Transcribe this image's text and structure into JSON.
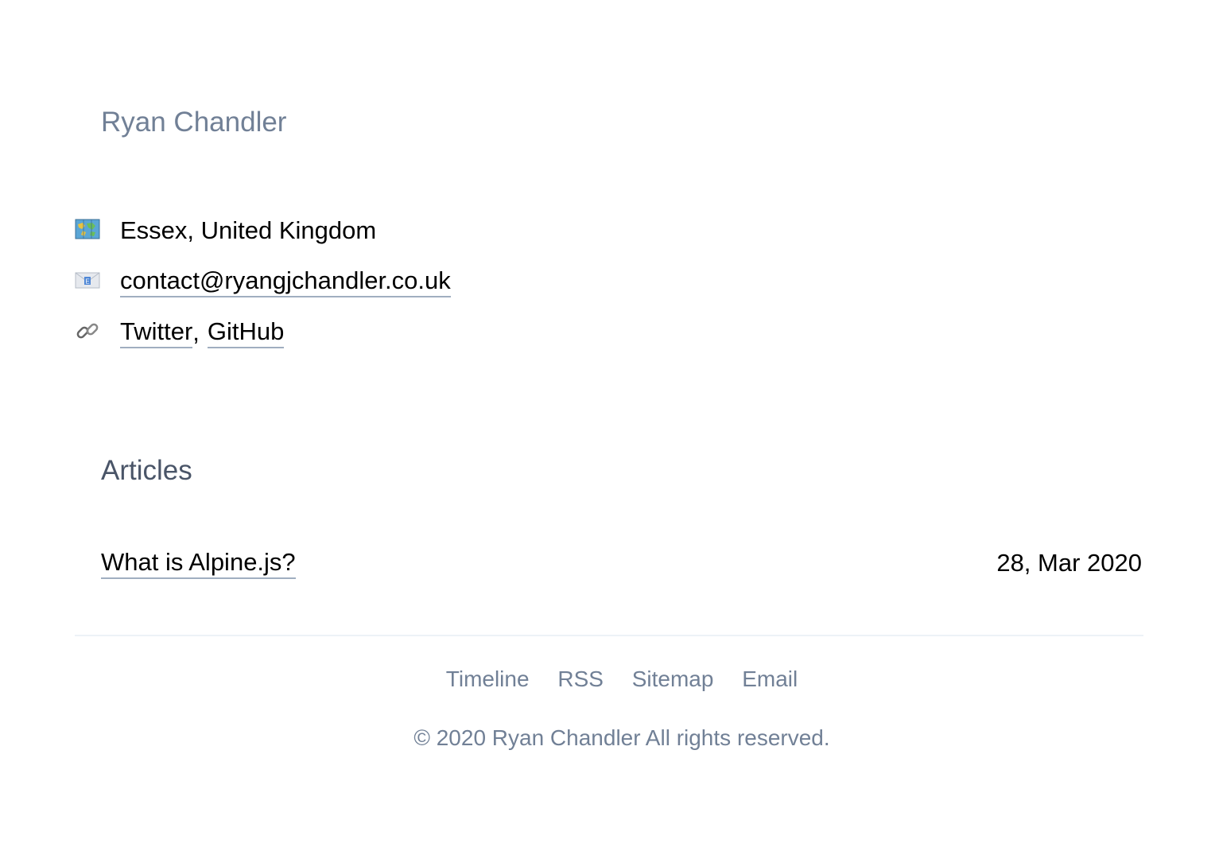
{
  "header": {
    "site_name": "Ryan Chandler"
  },
  "info": {
    "location": {
      "icon": "world-map-icon",
      "text": "Essex, United Kingdom"
    },
    "email": {
      "icon": "envelope-icon",
      "text": "contact@ryangjchandler.co.uk"
    },
    "links": {
      "icon": "link-icon",
      "twitter": "Twitter",
      "separator": ",",
      "github": "GitHub"
    }
  },
  "articles": {
    "title": "Articles",
    "items": [
      {
        "title": "What is Alpine.js?",
        "date": "28, Mar 2020"
      }
    ]
  },
  "footer": {
    "nav": [
      "Timeline",
      "RSS",
      "Sitemap",
      "Email"
    ],
    "copyright": "© 2020 Ryan Chandler All rights reserved."
  },
  "colors": {
    "muted": "#718096",
    "heading": "#4a5568",
    "underline": "#a0aec0",
    "rule": "#edf2f7"
  }
}
